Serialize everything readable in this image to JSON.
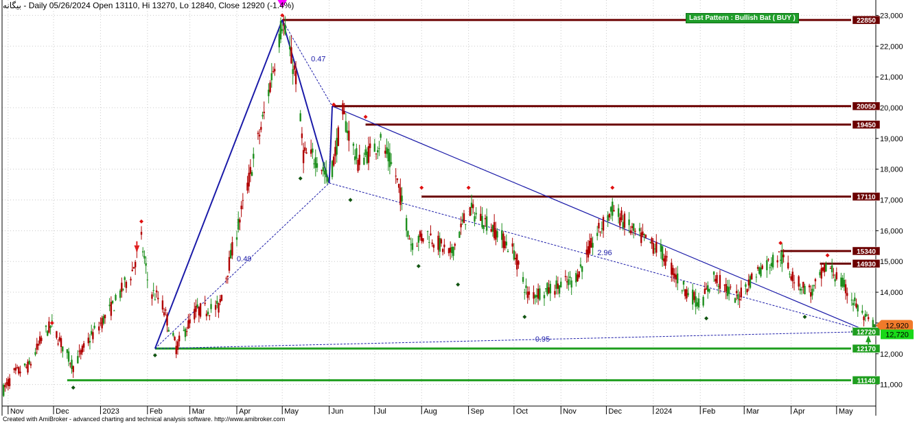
{
  "header": {
    "title": "بیگانه - Daily 05/26/2024 Open 13110, Hi 13270, Lo 12840, Close 12920 (-1.4%)"
  },
  "footer": {
    "credit": "Created with AmiBroker - advanced charting and technical analysis software. http://www.amibroker.com"
  },
  "pattern": {
    "label": "Last Pattern : Bullish Bat ( BUY )"
  },
  "colors": {
    "resistance": "#6b0000",
    "support": "#1e9e1e",
    "pattern_line": "#1a1aa8",
    "last_price": "#f07a2a",
    "up_candle": "#1e8f1e",
    "down_candle": "#b00000",
    "grid": "#c8c8c8"
  },
  "chart_data": {
    "type": "candlestick",
    "x_axis": {
      "type": "date",
      "start": "2022-10-28",
      "end": "2024-05-26",
      "tick_labels": [
        {
          "label": "Nov",
          "date": "2022-11-01"
        },
        {
          "label": "Dec",
          "date": "2022-12-01"
        },
        {
          "label": "2023",
          "date": "2023-01-01"
        },
        {
          "label": "Feb",
          "date": "2023-02-01"
        },
        {
          "label": "Mar",
          "date": "2023-03-01"
        },
        {
          "label": "Apr",
          "date": "2023-04-01"
        },
        {
          "label": "May",
          "date": "2023-05-01"
        },
        {
          "label": "Jun",
          "date": "2023-06-01"
        },
        {
          "label": "Jul",
          "date": "2023-07-01"
        },
        {
          "label": "Aug",
          "date": "2023-08-01"
        },
        {
          "label": "Sep",
          "date": "2023-09-01"
        },
        {
          "label": "Oct",
          "date": "2023-10-01"
        },
        {
          "label": "Nov",
          "date": "2023-11-01"
        },
        {
          "label": "Dec",
          "date": "2023-12-01"
        },
        {
          "label": "2024",
          "date": "2024-01-01"
        },
        {
          "label": "Feb",
          "date": "2024-02-01"
        },
        {
          "label": "Mar",
          "date": "2024-03-01"
        },
        {
          "label": "Apr",
          "date": "2024-04-01"
        },
        {
          "label": "May",
          "date": "2024-05-01"
        }
      ]
    },
    "y_axis": {
      "range": [
        10300,
        23500
      ],
      "ticks": [
        11000,
        12000,
        13000,
        14000,
        15000,
        16000,
        17000,
        18000,
        19000,
        20000,
        21000,
        22000,
        23000
      ],
      "tick_labels": [
        "11,000",
        "12,000",
        "13,000",
        "14,000",
        "15,000",
        "16,000",
        "17,000",
        "18,000",
        "19,000",
        "20,000",
        "21,000",
        "22,000",
        "23,000"
      ],
      "grid": true,
      "position": "right"
    },
    "price_path": [
      [
        "2022-10-28",
        10750
      ],
      [
        "2022-11-05",
        11350
      ],
      [
        "2022-11-15",
        11600
      ],
      [
        "2022-11-25",
        12700
      ],
      [
        "2022-11-30",
        12900
      ],
      [
        "2022-12-08",
        12150
      ],
      [
        "2022-12-14",
        11600
      ],
      [
        "2022-12-25",
        12500
      ],
      [
        "2023-01-10",
        13600
      ],
      [
        "2023-01-22",
        14700
      ],
      [
        "2023-01-28",
        15700
      ],
      [
        "2023-02-02",
        14100
      ],
      [
        "2023-02-10",
        13700
      ],
      [
        "2023-02-20",
        12200
      ],
      [
        "2023-03-05",
        13400
      ],
      [
        "2023-03-20",
        13500
      ],
      [
        "2023-04-05",
        16800
      ],
      [
        "2023-04-20",
        20000
      ],
      [
        "2023-05-01",
        22800
      ],
      [
        "2023-05-10",
        21000
      ],
      [
        "2023-05-15",
        18500
      ],
      [
        "2023-05-25",
        18300
      ],
      [
        "2023-06-01",
        17550
      ],
      [
        "2023-06-10",
        19800
      ],
      [
        "2023-06-20",
        18200
      ],
      [
        "2023-07-05",
        18900
      ],
      [
        "2023-07-15",
        17800
      ],
      [
        "2023-07-25",
        15600
      ],
      [
        "2023-08-05",
        15900
      ],
      [
        "2023-08-20",
        15200
      ],
      [
        "2023-09-01",
        16700
      ],
      [
        "2023-09-15",
        16200
      ],
      [
        "2023-10-01",
        15300
      ],
      [
        "2023-10-10",
        13900
      ],
      [
        "2023-10-25",
        14100
      ],
      [
        "2023-11-10",
        14400
      ],
      [
        "2023-11-25",
        15900
      ],
      [
        "2023-12-05",
        16700
      ],
      [
        "2023-12-20",
        15900
      ],
      [
        "2024-01-05",
        15400
      ],
      [
        "2024-01-20",
        14200
      ],
      [
        "2024-02-01",
        13600
      ],
      [
        "2024-02-10",
        14500
      ],
      [
        "2024-02-25",
        13800
      ],
      [
        "2024-03-10",
        14700
      ],
      [
        "2024-03-25",
        15200
      ],
      [
        "2024-04-05",
        14300
      ],
      [
        "2024-04-15",
        14000
      ],
      [
        "2024-04-25",
        14900
      ],
      [
        "2024-05-10",
        13900
      ],
      [
        "2024-05-20",
        13100
      ],
      [
        "2024-05-26",
        12920
      ]
    ],
    "horizontal_levels": [
      {
        "value": 22850,
        "label": "22850",
        "kind": "resistance",
        "from": "2023-05-01"
      },
      {
        "value": 20050,
        "label": "20050",
        "kind": "resistance",
        "from": "2023-06-03"
      },
      {
        "value": 19450,
        "label": "19450",
        "kind": "resistance",
        "from": "2023-06-25"
      },
      {
        "value": 17110,
        "label": "17110",
        "kind": "resistance",
        "from": "2023-08-01"
      },
      {
        "value": 15340,
        "label": "15340",
        "kind": "resistance",
        "from": "2024-03-25"
      },
      {
        "value": 14930,
        "label": "14930",
        "kind": "resistance",
        "from": "2024-04-20"
      },
      {
        "value": 12720,
        "label": "12720",
        "kind": "support",
        "from": "2024-05-22"
      },
      {
        "value": 12170,
        "label": "12170",
        "kind": "support",
        "from": "2023-02-06"
      },
      {
        "value": 11140,
        "label": "11140",
        "kind": "support",
        "from": "2022-12-10"
      }
    ],
    "last_price": {
      "value": 12920,
      "label": "12,920"
    },
    "last_price_secondary": {
      "value": 12720,
      "label": "12,720"
    },
    "harmonic_pattern": {
      "name": "Bullish Bat",
      "points": [
        [
          "2023-02-06",
          12170
        ],
        [
          "2023-05-01",
          22850
        ],
        [
          "2023-06-01",
          17550
        ],
        [
          "2023-06-03",
          20050
        ],
        [
          "2024-05-22",
          12720
        ]
      ],
      "ratios": [
        {
          "text": "0.47",
          "date": "2023-05-20",
          "value": 21500
        },
        {
          "text": "0.49",
          "date": "2023-04-01",
          "value": 15000
        },
        {
          "text": "2.96",
          "date": "2023-11-25",
          "value": 15200
        },
        {
          "text": "0.95",
          "date": "2023-10-15",
          "value": 12400
        }
      ]
    },
    "pivot_highs": [
      [
        "2022-11-30",
        13000
      ],
      [
        "2023-01-28",
        16300
      ],
      [
        "2023-05-01",
        23000
      ],
      [
        "2023-06-04",
        20100
      ],
      [
        "2023-06-25",
        19700
      ],
      [
        "2023-08-01",
        17400
      ],
      [
        "2023-09-01",
        17400
      ],
      [
        "2023-12-05",
        17400
      ],
      [
        "2024-03-25",
        15600
      ],
      [
        "2024-04-25",
        15200
      ]
    ],
    "pivot_lows": [
      [
        "2022-12-14",
        10900
      ],
      [
        "2023-02-06",
        11950
      ],
      [
        "2023-05-13",
        17700
      ],
      [
        "2023-06-15",
        17000
      ],
      [
        "2023-07-30",
        14850
      ],
      [
        "2023-08-25",
        14250
      ],
      [
        "2023-10-08",
        13200
      ],
      [
        "2024-02-05",
        13150
      ],
      [
        "2024-04-10",
        13200
      ]
    ],
    "signal_arrows": [
      {
        "kind": "down",
        "date": "2023-01-25",
        "value": 15300
      },
      {
        "kind": "peak",
        "date": "2023-05-01",
        "value": 23150
      },
      {
        "kind": "up",
        "date": "2024-05-22",
        "value": 12600
      }
    ]
  }
}
